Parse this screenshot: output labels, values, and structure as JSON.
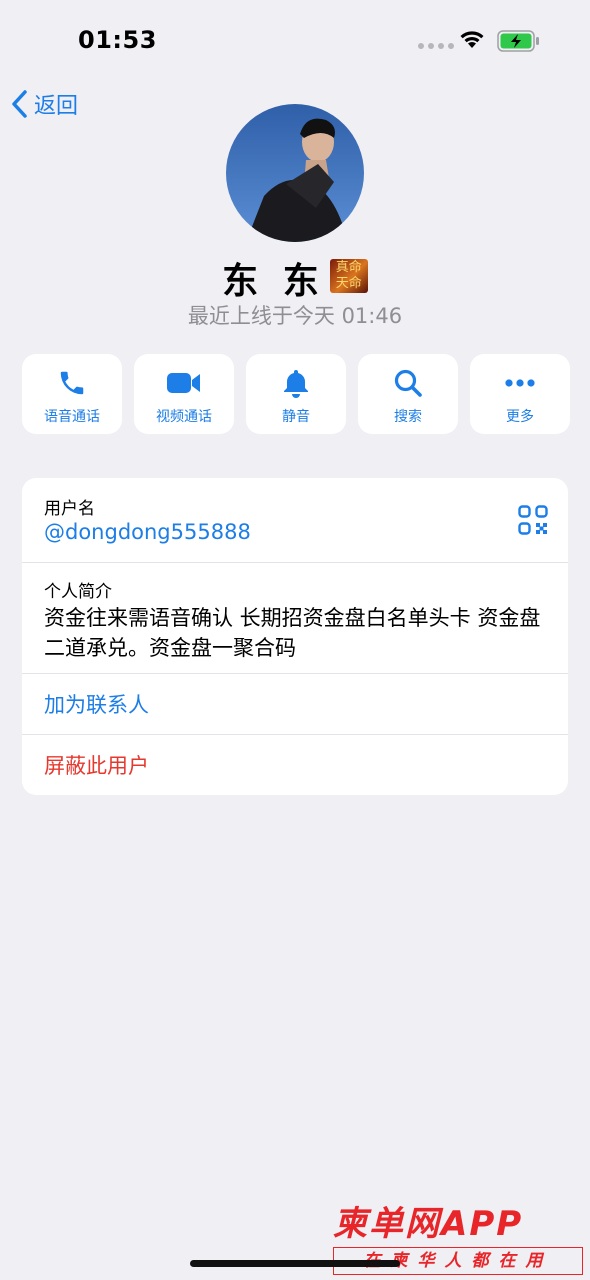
{
  "status_bar": {
    "time": "01:53"
  },
  "nav": {
    "back_label": "返回"
  },
  "profile": {
    "name": "东 东",
    "badge_text": "真命天命",
    "last_seen": "最近上线于今天 01:46"
  },
  "actions": [
    {
      "label": "语音通话",
      "icon": "phone-icon"
    },
    {
      "label": "视频通话",
      "icon": "video-camera-icon"
    },
    {
      "label": "静音",
      "icon": "bell-icon"
    },
    {
      "label": "搜索",
      "icon": "search-icon"
    },
    {
      "label": "更多",
      "icon": "more-dots-icon"
    }
  ],
  "info": {
    "username_label": "用户名",
    "username_value": "@dongdong555888",
    "bio_label": "个人简介",
    "bio_value": "资金往来需语音确认 长期招资金盘白名单头卡 资金盘二道承兑。资金盘一聚合码",
    "add_contact_label": "加为联系人",
    "block_user_label": "屏蔽此用户"
  },
  "watermark": {
    "top": "柬单网APP",
    "bottom": "在柬华人都在用"
  },
  "colors": {
    "accent": "#1c7ee6",
    "danger": "#e5392f",
    "background": "#efeff4"
  }
}
